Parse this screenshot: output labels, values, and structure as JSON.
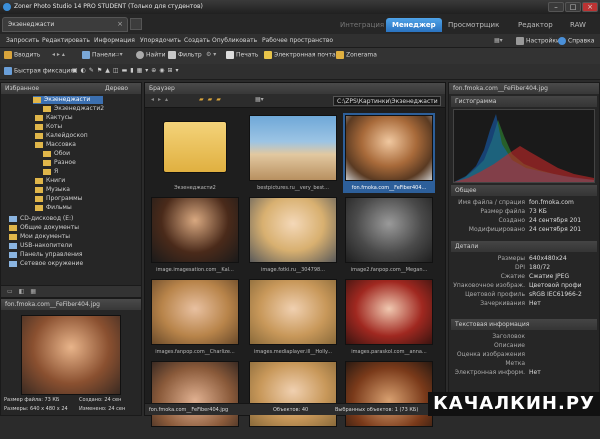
{
  "window": {
    "title": "Zoner Photo Studio 14 PRO STUDENT (Только для студентов)"
  },
  "doc_tab": {
    "label": "Экзенеджасти"
  },
  "modes": [
    {
      "label": "Интеграция"
    },
    {
      "label": "Менеджер"
    },
    {
      "label": "Просмотрщик"
    },
    {
      "label": "Редактор"
    },
    {
      "label": "RAW"
    }
  ],
  "menu": [
    "Запросить",
    "Редактировать",
    "Информация",
    "Упорядочить",
    "Создать",
    "Опубликовать",
    "Рабочее пространство"
  ],
  "menu_right": {
    "settings": "Настройки",
    "help": "Справка"
  },
  "toolbar1": {
    "import": "Вводить",
    "panels": "Панели",
    "find": "Найти",
    "filter": "Фильтр",
    "print": "Печать",
    "email": "Электронная почта",
    "zonerama": "Zonerama"
  },
  "toolbar2": {
    "quick_fix": "Быстрая фиксация"
  },
  "left_panel": {
    "header": "Избранное",
    "tab": "Дерево",
    "tree": [
      {
        "label": "Экзенеджасти",
        "selected": true
      },
      {
        "label": "Экзенеджасти2"
      },
      {
        "label": "Кактусы"
      },
      {
        "label": "Коты"
      },
      {
        "label": "Калейдоскоп"
      },
      {
        "label": "Массовка"
      },
      {
        "label": "Обои"
      },
      {
        "label": "Разное"
      },
      {
        "label": "Я"
      },
      {
        "label": "Книги"
      },
      {
        "label": "Музыка"
      },
      {
        "label": "Программы"
      },
      {
        "label": "Фильмы"
      },
      {
        "label": "CD-дисковод (E:)"
      },
      {
        "label": "Общие документы"
      },
      {
        "label": "Мои документы"
      },
      {
        "label": "USB-накопители"
      },
      {
        "label": "Панель управления"
      },
      {
        "label": "Сетевое окружение"
      }
    ]
  },
  "preview": {
    "header": "fon.fmoka.com__FeFiber404.jpg",
    "size": "Размер файла: 73 КБ",
    "created": "Создано: 24 сен",
    "dimensions": "Размеры: 640 x 480 x 24",
    "modified": "Изменено: 24 сен"
  },
  "browser": {
    "header": "Браузер",
    "path": "C:\\ZPS\\Картинки\\Экзенеджасти",
    "thumbs": [
      {
        "caption": "Экзенеджасти2",
        "kind": "folder"
      },
      {
        "caption": "bestpictures.ru__very_best...",
        "kind": "photo",
        "palette": "beach"
      },
      {
        "caption": "fon.fmoka.com__FeFiber404...",
        "kind": "photo",
        "palette": "curly",
        "selected": true
      },
      {
        "caption": "image.imagesation.com__Kal...",
        "kind": "photo",
        "palette": "dark"
      },
      {
        "caption": "image.fotki.ru__304798...",
        "kind": "photo",
        "palette": "blonde"
      },
      {
        "caption": "image2.fanpop.com__Megan...",
        "kind": "photo",
        "palette": "bw"
      },
      {
        "caption": "images.fanpop.com__Charlize...",
        "kind": "photo",
        "palette": "face1"
      },
      {
        "caption": "images.mediaplayer.ill__Holly...",
        "kind": "photo",
        "palette": "face2"
      },
      {
        "caption": "images.paraskol.com__anna...",
        "kind": "photo",
        "palette": "redhead"
      },
      {
        "caption": "",
        "kind": "photo",
        "palette": "face3"
      },
      {
        "caption": "",
        "kind": "photo",
        "palette": "face2"
      },
      {
        "caption": "",
        "kind": "photo",
        "palette": "face4"
      }
    ],
    "status": {
      "file": "fon.fmoka.com__FeFiber404.jpg",
      "objects": "Объектов: 40",
      "selected": "Выбранных объектов: 1 (73 КБ)"
    }
  },
  "info_panel": {
    "header": "Гистограмма",
    "file_header": "fon.fmoka.com__FeFiber404.jpg",
    "sections": {
      "general": "Общее",
      "details": "Детали",
      "text": "Текстовая информация"
    },
    "general": [
      {
        "k": "Имя файла / спрация",
        "v": "fon.fmoka.com"
      },
      {
        "k": "Размер файла",
        "v": "73 КБ"
      },
      {
        "k": "Создано",
        "v": "24 сентября 201"
      },
      {
        "k": "Модифицировано",
        "v": "24 сентября 201"
      }
    ],
    "details": [
      {
        "k": "Размеры",
        "v": "640x480x24"
      },
      {
        "k": "DPI",
        "v": "180/72"
      },
      {
        "k": "Сжатие",
        "v": "Сжатие JPEG"
      },
      {
        "k": "Упаковочное изображ.",
        "v": "Цветовой профи"
      },
      {
        "k": "Цветовой профиль",
        "v": "sRGB IEC61966-2"
      },
      {
        "k": "Зачеркивания",
        "v": "Нет"
      }
    ],
    "text_rows": [
      {
        "k": "Заголовок",
        "v": ""
      },
      {
        "k": "Описание",
        "v": ""
      },
      {
        "k": "Оценка изображения",
        "v": ""
      },
      {
        "k": "Метка",
        "v": ""
      },
      {
        "k": "Электронная информ.",
        "v": "Нет"
      }
    ]
  },
  "watermark": "КАЧАЛКИН.РУ",
  "colors": {
    "accent": "#2a73c0",
    "selection": "#2d5f9a"
  }
}
